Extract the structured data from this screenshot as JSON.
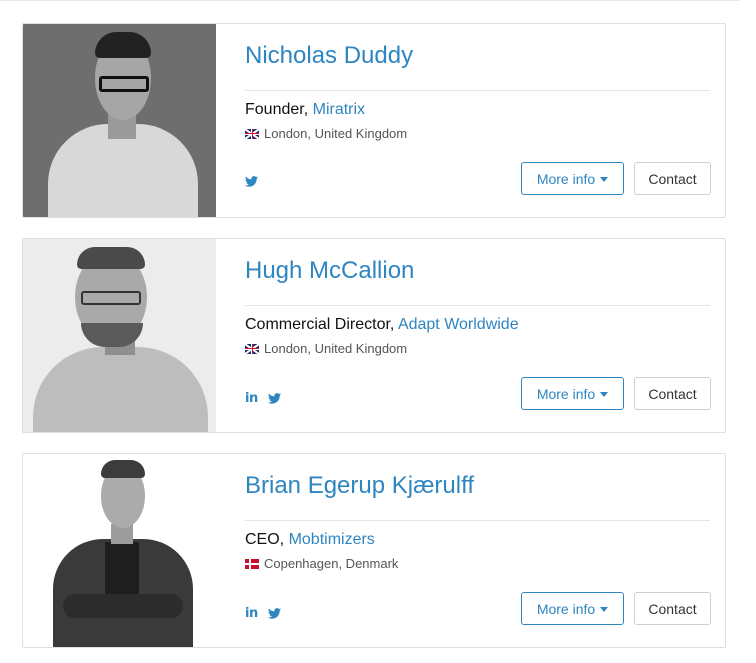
{
  "people": [
    {
      "name": "Nicholas Duddy",
      "title": "Founder",
      "company": "Miratrix",
      "flag": "uk-flag-icon",
      "location": "London, United Kingdom",
      "socials": [
        "twitter-icon"
      ],
      "more_info_label": "More info",
      "contact_label": "Contact"
    },
    {
      "name": "Hugh McCallion",
      "title": "Commercial Director",
      "company": "Adapt Worldwide",
      "flag": "uk-flag-icon",
      "location": "London, United Kingdom",
      "socials": [
        "linkedin-icon",
        "twitter-icon"
      ],
      "more_info_label": "More info",
      "contact_label": "Contact"
    },
    {
      "name": "Brian Egerup Kjærulff",
      "title": "CEO",
      "company": "Mobtimizers",
      "flag": "denmark-flag-icon",
      "location": "Copenhagen, Denmark",
      "socials": [
        "linkedin-icon",
        "twitter-icon"
      ],
      "more_info_label": "More info",
      "contact_label": "Contact"
    }
  ],
  "colors": {
    "accent": "#2e86c1",
    "border": "#dfdfdf",
    "text": "#111111"
  }
}
